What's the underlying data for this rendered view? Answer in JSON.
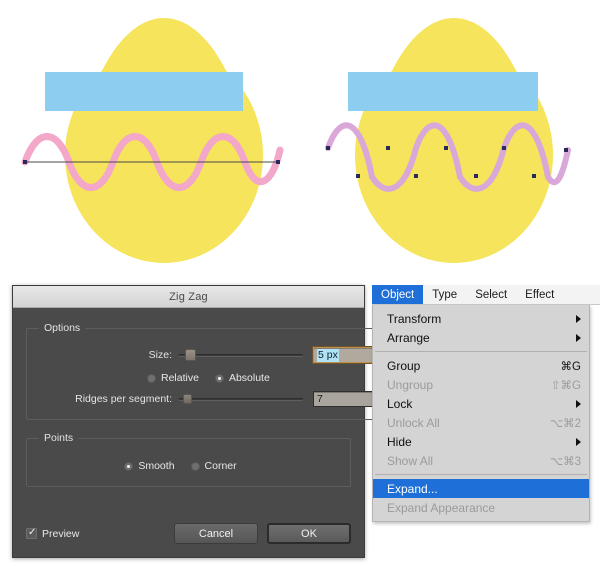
{
  "artwork": {
    "description": "Two yellow easter egg illustrations with a light blue horizontal band and a wavy zigzag path across each",
    "colors": {
      "egg_fill": "#f5e45c",
      "band_fill": "#8dcef0",
      "wave_left_stroke": "#f3a7c9",
      "wave_right_stroke": "#d9a8d8",
      "path_line": "#3a3a3a",
      "anchor_point": "#2a2a5a",
      "canvas": "#ffffff"
    },
    "left_egg": {
      "label": "egg-before-expand",
      "waves": 5
    },
    "right_egg": {
      "label": "egg-after-expand",
      "waves": 5
    }
  },
  "dialog": {
    "title": "Zig Zag",
    "options": {
      "legend": "Options",
      "size_label": "Size:",
      "size_value": "5",
      "size_unit": "px",
      "size_value_full": "5 px",
      "relative_label": "Relative",
      "absolute_label": "Absolute",
      "selected_mode": "Absolute",
      "ridges_label": "Ridges per segment:",
      "ridges_value": "7"
    },
    "points": {
      "legend": "Points",
      "smooth_label": "Smooth",
      "corner_label": "Corner",
      "selected_point": "Smooth"
    },
    "footer": {
      "preview_label": "Preview",
      "preview_checked": true,
      "cancel_label": "Cancel",
      "ok_label": "OK"
    }
  },
  "menu": {
    "bar": [
      {
        "label": "Object",
        "active": true
      },
      {
        "label": "Type",
        "active": false
      },
      {
        "label": "Select",
        "active": false
      },
      {
        "label": "Effect",
        "active": false
      }
    ],
    "items": [
      {
        "label": "Transform",
        "shortcut": "",
        "submenu": true,
        "disabled": false,
        "highlight": false
      },
      {
        "label": "Arrange",
        "shortcut": "",
        "submenu": true,
        "disabled": false,
        "highlight": false
      },
      {
        "separator": true
      },
      {
        "label": "Group",
        "shortcut": "⌘G",
        "submenu": false,
        "disabled": false,
        "highlight": false
      },
      {
        "label": "Ungroup",
        "shortcut": "⇧⌘G",
        "submenu": false,
        "disabled": true,
        "highlight": false
      },
      {
        "label": "Lock",
        "shortcut": "",
        "submenu": true,
        "disabled": false,
        "highlight": false
      },
      {
        "label": "Unlock All",
        "shortcut": "⌥⌘2",
        "submenu": false,
        "disabled": true,
        "highlight": false
      },
      {
        "label": "Hide",
        "shortcut": "",
        "submenu": true,
        "disabled": false,
        "highlight": false
      },
      {
        "label": "Show All",
        "shortcut": "⌥⌘3",
        "submenu": false,
        "disabled": true,
        "highlight": false
      },
      {
        "separator": true
      },
      {
        "label": "Expand...",
        "shortcut": "",
        "submenu": false,
        "disabled": false,
        "highlight": true
      },
      {
        "label": "Expand Appearance",
        "shortcut": "",
        "submenu": false,
        "disabled": true,
        "highlight": false
      }
    ]
  }
}
